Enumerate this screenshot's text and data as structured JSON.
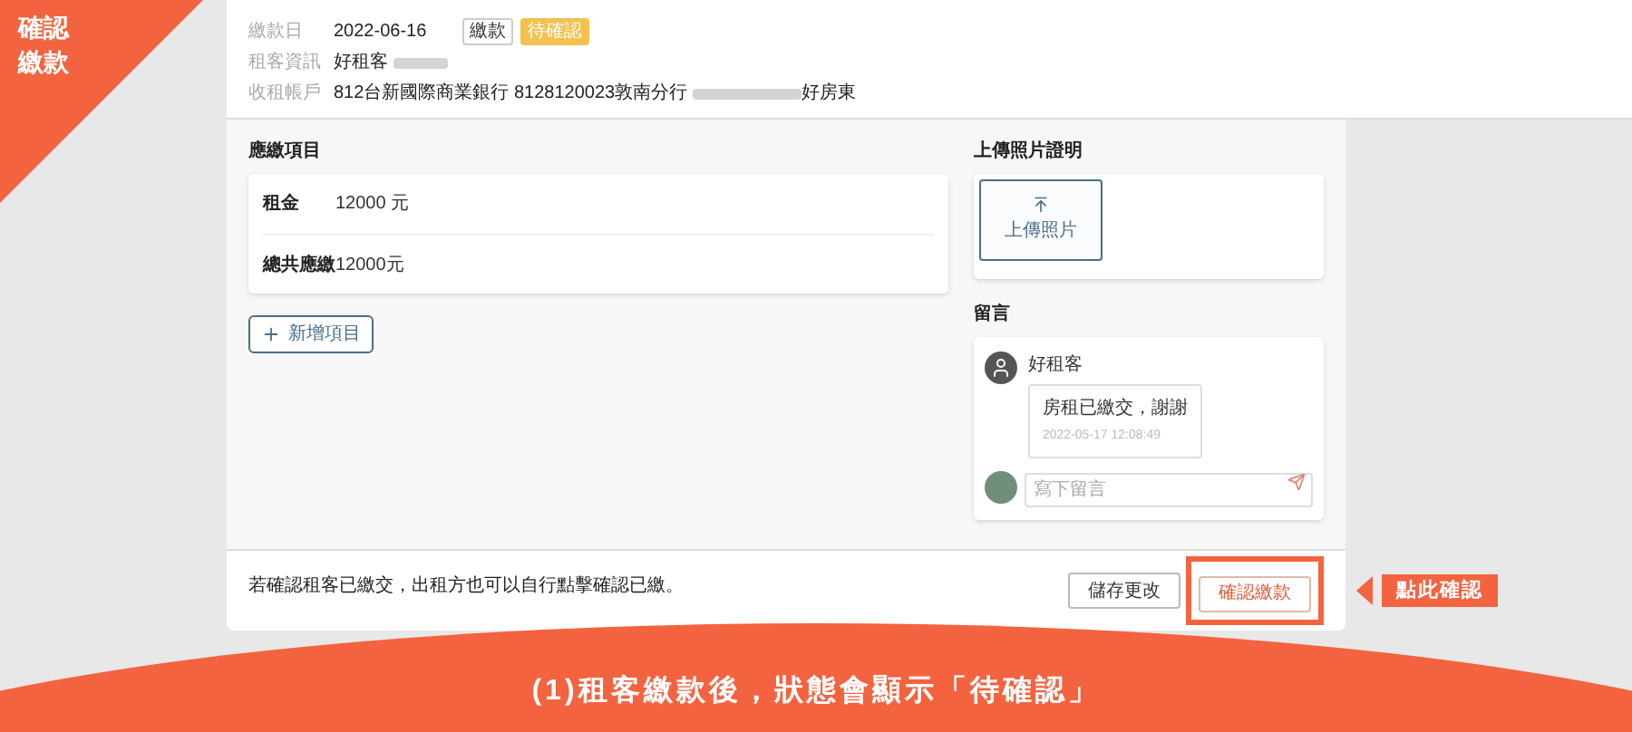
{
  "corner_label": "確認繳款",
  "payment_info": {
    "rows": [
      {
        "label": "繳款日",
        "value": "2022-06-16",
        "redacted": false
      },
      {
        "label": "租客資訊",
        "value": "好租客",
        "redacted": true
      },
      {
        "label": "收租帳戶",
        "value": "812台新國際商業銀行 8128120023敦南分行",
        "redacted": true,
        "suffix": "好房東"
      }
    ],
    "badges": [
      {
        "text": "繳款",
        "kind": "type"
      },
      {
        "text": "待確認",
        "kind": "status"
      }
    ]
  },
  "charges": {
    "title": "應繳項目",
    "items": [
      {
        "name": "租金",
        "amount": "12000 元"
      },
      {
        "name": "總共應繳",
        "amount": "12000元"
      }
    ],
    "add_button": "新增項目"
  },
  "upload": {
    "title": "上傳照片證明",
    "button": "上傳照片"
  },
  "comments": {
    "title": "留言",
    "items": [
      {
        "author": "好租客",
        "text": "房租已繳交，謝謝",
        "time": "2022-05-17 12:08:49"
      }
    ],
    "input": {
      "placeholder": "寫下留言"
    }
  },
  "footer": {
    "note": "若確認租客已繳交，出租方也可以自行點擊確認已繳。",
    "buttons": [
      {
        "label": "儲存更改",
        "kind": "secondary"
      },
      {
        "label": "確認繳款",
        "kind": "primary",
        "highlighted": true
      }
    ]
  },
  "callout": "點此確認",
  "banner": "(1)租客繳款後，狀態會顯示「待確認」"
}
